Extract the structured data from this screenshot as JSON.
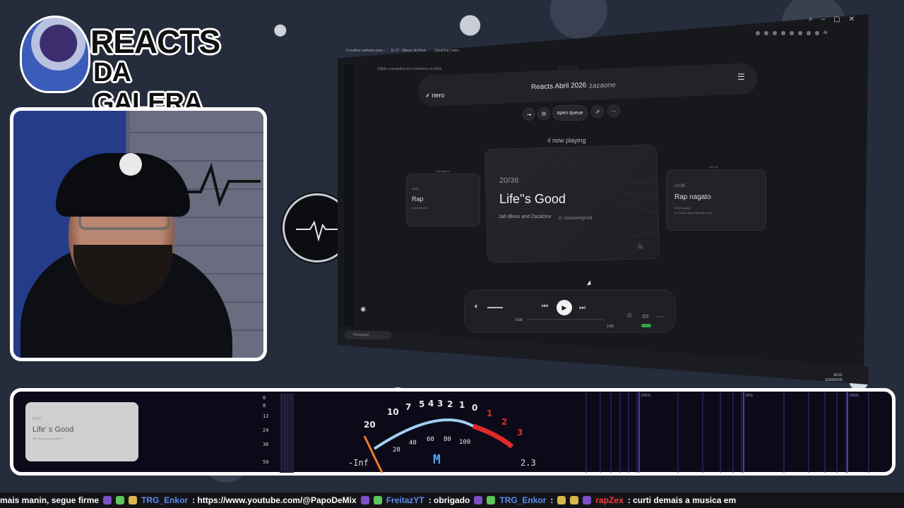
{
  "logo": {
    "line1": "REACTS",
    "line2": "DA GALERA"
  },
  "browser": {
    "tabs": [
      "O melhor software para ...",
      "Ei 27 · Álbum de Rock ...",
      "ZazaOne | nero"
    ],
    "address_placeholder": "Digite a pesquisa ou o endereço da Web",
    "ai_label": "AI",
    "taskbar_search": "Pesquisar",
    "clock_time": "18:31",
    "clock_date": "11/04/2026"
  },
  "nero": {
    "watermark": "nero",
    "logo_text": "nero",
    "title": "Reacts Abril 2026",
    "subtitle": "zazaone",
    "open_queue_label": "open queue",
    "now_playing_label": "now playing",
    "prev_card": {
      "label": "last played",
      "counter": "19/36",
      "title": "Rap",
      "artist": "Kyron Nova"
    },
    "current": {
      "counter": "20/36",
      "title": "Life''s Good",
      "artist": "Jah Bless and ZazaOne",
      "handle": "zazaoneprod"
    },
    "next_card": {
      "label": "next up",
      "counter": "21/36",
      "title": "Rap nagato",
      "artist": "Kevin Iguaçu",
      "note": "for ZAZA vários hip-hop e voo"
    },
    "player": {
      "elapsed": "0:00",
      "duration": "2:05",
      "progress": 0.0
    }
  },
  "mini_card": {
    "counter": "20/36",
    "title": "Life' s Good",
    "artist": "Jah Bless and ZazaOne"
  },
  "meter": {
    "scale": [
      "0",
      "8",
      "12",
      "24",
      "36",
      "50"
    ],
    "top_numbers": [
      "20",
      "10",
      "7",
      "5",
      "4",
      "3",
      "2",
      "1",
      "0"
    ],
    "red_numbers": [
      "1",
      "2",
      "3"
    ],
    "inner_numbers": [
      "20",
      "40",
      "60",
      "80",
      "100"
    ],
    "left_value": "-Inf",
    "right_value": "2.3",
    "mode": "M"
  },
  "spectrum": {
    "labels": [
      "100Hz",
      "1kHz",
      "10kHz"
    ]
  },
  "ticker": {
    "segments": [
      {
        "type": "text",
        "text": "mais manin, segue firme"
      },
      {
        "type": "user",
        "text": "TRG_Enkor"
      },
      {
        "type": "text",
        "text": ": https://www.youtube.com/@PapoDeMix"
      },
      {
        "type": "user",
        "text": "FreitazYT"
      },
      {
        "type": "text",
        "text": ": obrigado"
      },
      {
        "type": "user",
        "text": "TRG_Enkor"
      },
      {
        "type": "text",
        "text": ":"
      },
      {
        "type": "user2",
        "text": "rapZex"
      },
      {
        "type": "text",
        "text": ": curti demais a musica em"
      }
    ]
  }
}
